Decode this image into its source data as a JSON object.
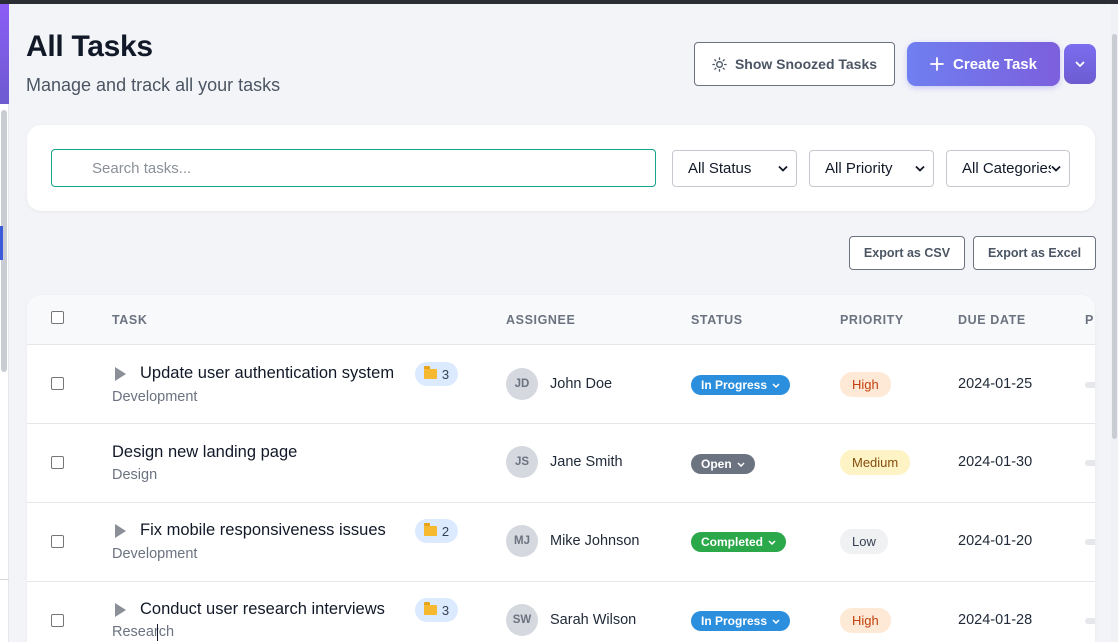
{
  "header": {
    "title": "All Tasks",
    "subtitle": "Manage and track all your tasks",
    "snoozed_button": "Show Snoozed Tasks",
    "create_button": "Create Task"
  },
  "filters": {
    "search_placeholder": "Search tasks...",
    "status_value": "All Status",
    "priority_value": "All Priority",
    "category_value": "All Categories"
  },
  "export": {
    "csv": "Export as CSV",
    "excel": "Export as Excel"
  },
  "table": {
    "columns": [
      "TASK",
      "ASSIGNEE",
      "STATUS",
      "PRIORITY",
      "DUE DATE",
      "P"
    ],
    "rows": [
      {
        "title": "Update user authentication system",
        "category": "Development",
        "subtasks": "3",
        "initials": "JD",
        "assignee": "John Doe",
        "status": "In Progress",
        "priority": "High",
        "due": "2024-01-25"
      },
      {
        "title": "Design new landing page",
        "category": "Design",
        "initials": "JS",
        "assignee": "Jane Smith",
        "status": "Open",
        "priority": "Medium",
        "due": "2024-01-30"
      },
      {
        "title": "Fix mobile responsiveness issues",
        "category": "Development",
        "subtasks": "2",
        "initials": "MJ",
        "assignee": "Mike Johnson",
        "status": "Completed",
        "priority": "Low",
        "due": "2024-01-20"
      },
      {
        "title": "Conduct user research interviews",
        "category": "Research",
        "subtasks": "3",
        "initials": "SW",
        "assignee": "Sarah Wilson",
        "status": "In Progress",
        "priority": "High",
        "due": "2024-01-28"
      }
    ]
  },
  "colors": {
    "accent": "#6f7ff0",
    "status_in_progress": "#2b8fde",
    "status_open": "#6b7280",
    "status_completed": "#2aa84a",
    "priority_high_bg": "#fde9d6",
    "priority_medium_bg": "#fdf3c4",
    "priority_low_bg": "#f0f1f3"
  },
  "icons": {
    "snoozed": "sun-icon",
    "create": "plus-icon",
    "dropdown": "chevron-down-icon",
    "subtask": "folder-icon",
    "expand": "caret-right-icon"
  }
}
